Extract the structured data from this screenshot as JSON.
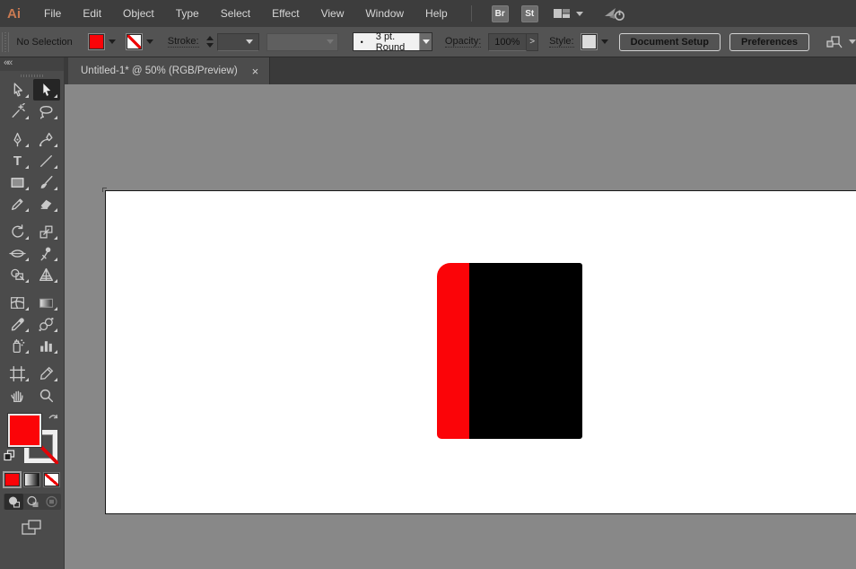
{
  "app": {
    "logo": "Ai",
    "name": "Adobe Illustrator"
  },
  "menubar": {
    "items": [
      "File",
      "Edit",
      "Object",
      "Type",
      "Select",
      "Effect",
      "View",
      "Window",
      "Help"
    ],
    "bridge_badge": "Br",
    "stock_badge": "St"
  },
  "controlbar": {
    "selection_status": "No Selection",
    "stroke_label": "Stroke:",
    "brush_dot": "•",
    "brush_name": "3 pt. Round",
    "opacity_label": "Opacity:",
    "opacity_value": "100%",
    "opacity_next_glyph": ">",
    "style_label": "Style:",
    "document_setup_label": "Document Setup",
    "preferences_label": "Preferences"
  },
  "tab": {
    "title": "Untitled-1* @ 50% (RGB/Preview)",
    "close_glyph": "×"
  },
  "toolbar": {
    "collapse_glyph": "««",
    "type_glyph": "T",
    "active_tool": "direct-selection",
    "tools": [
      "selection",
      "direct-selection",
      "magic-wand",
      "lasso",
      "pen",
      "curvature",
      "type",
      "line-segment",
      "rectangle",
      "paintbrush",
      "pencil",
      "eraser",
      "rotate",
      "scale",
      "width",
      "puppet-warp",
      "shape-builder",
      "perspective-grid",
      "mesh",
      "gradient",
      "eyedropper",
      "blend",
      "symbol-sprayer",
      "column-graph",
      "artboard",
      "slice",
      "hand",
      "zoom"
    ],
    "fill_color": "#fb0408",
    "stroke_color": "none",
    "color_buttons": [
      "color",
      "gradient",
      "none"
    ],
    "draw_modes": [
      "draw-normal",
      "draw-behind",
      "draw-inside"
    ],
    "active_draw_mode": "draw-normal"
  },
  "canvas": {
    "pasteboard_color": "#888888",
    "artboard_color": "#ffffff",
    "shape": {
      "red_bar_color": "#fb0408",
      "black_rect_color": "#000000",
      "description": "red rounded spine bar beside black rectangle"
    }
  }
}
